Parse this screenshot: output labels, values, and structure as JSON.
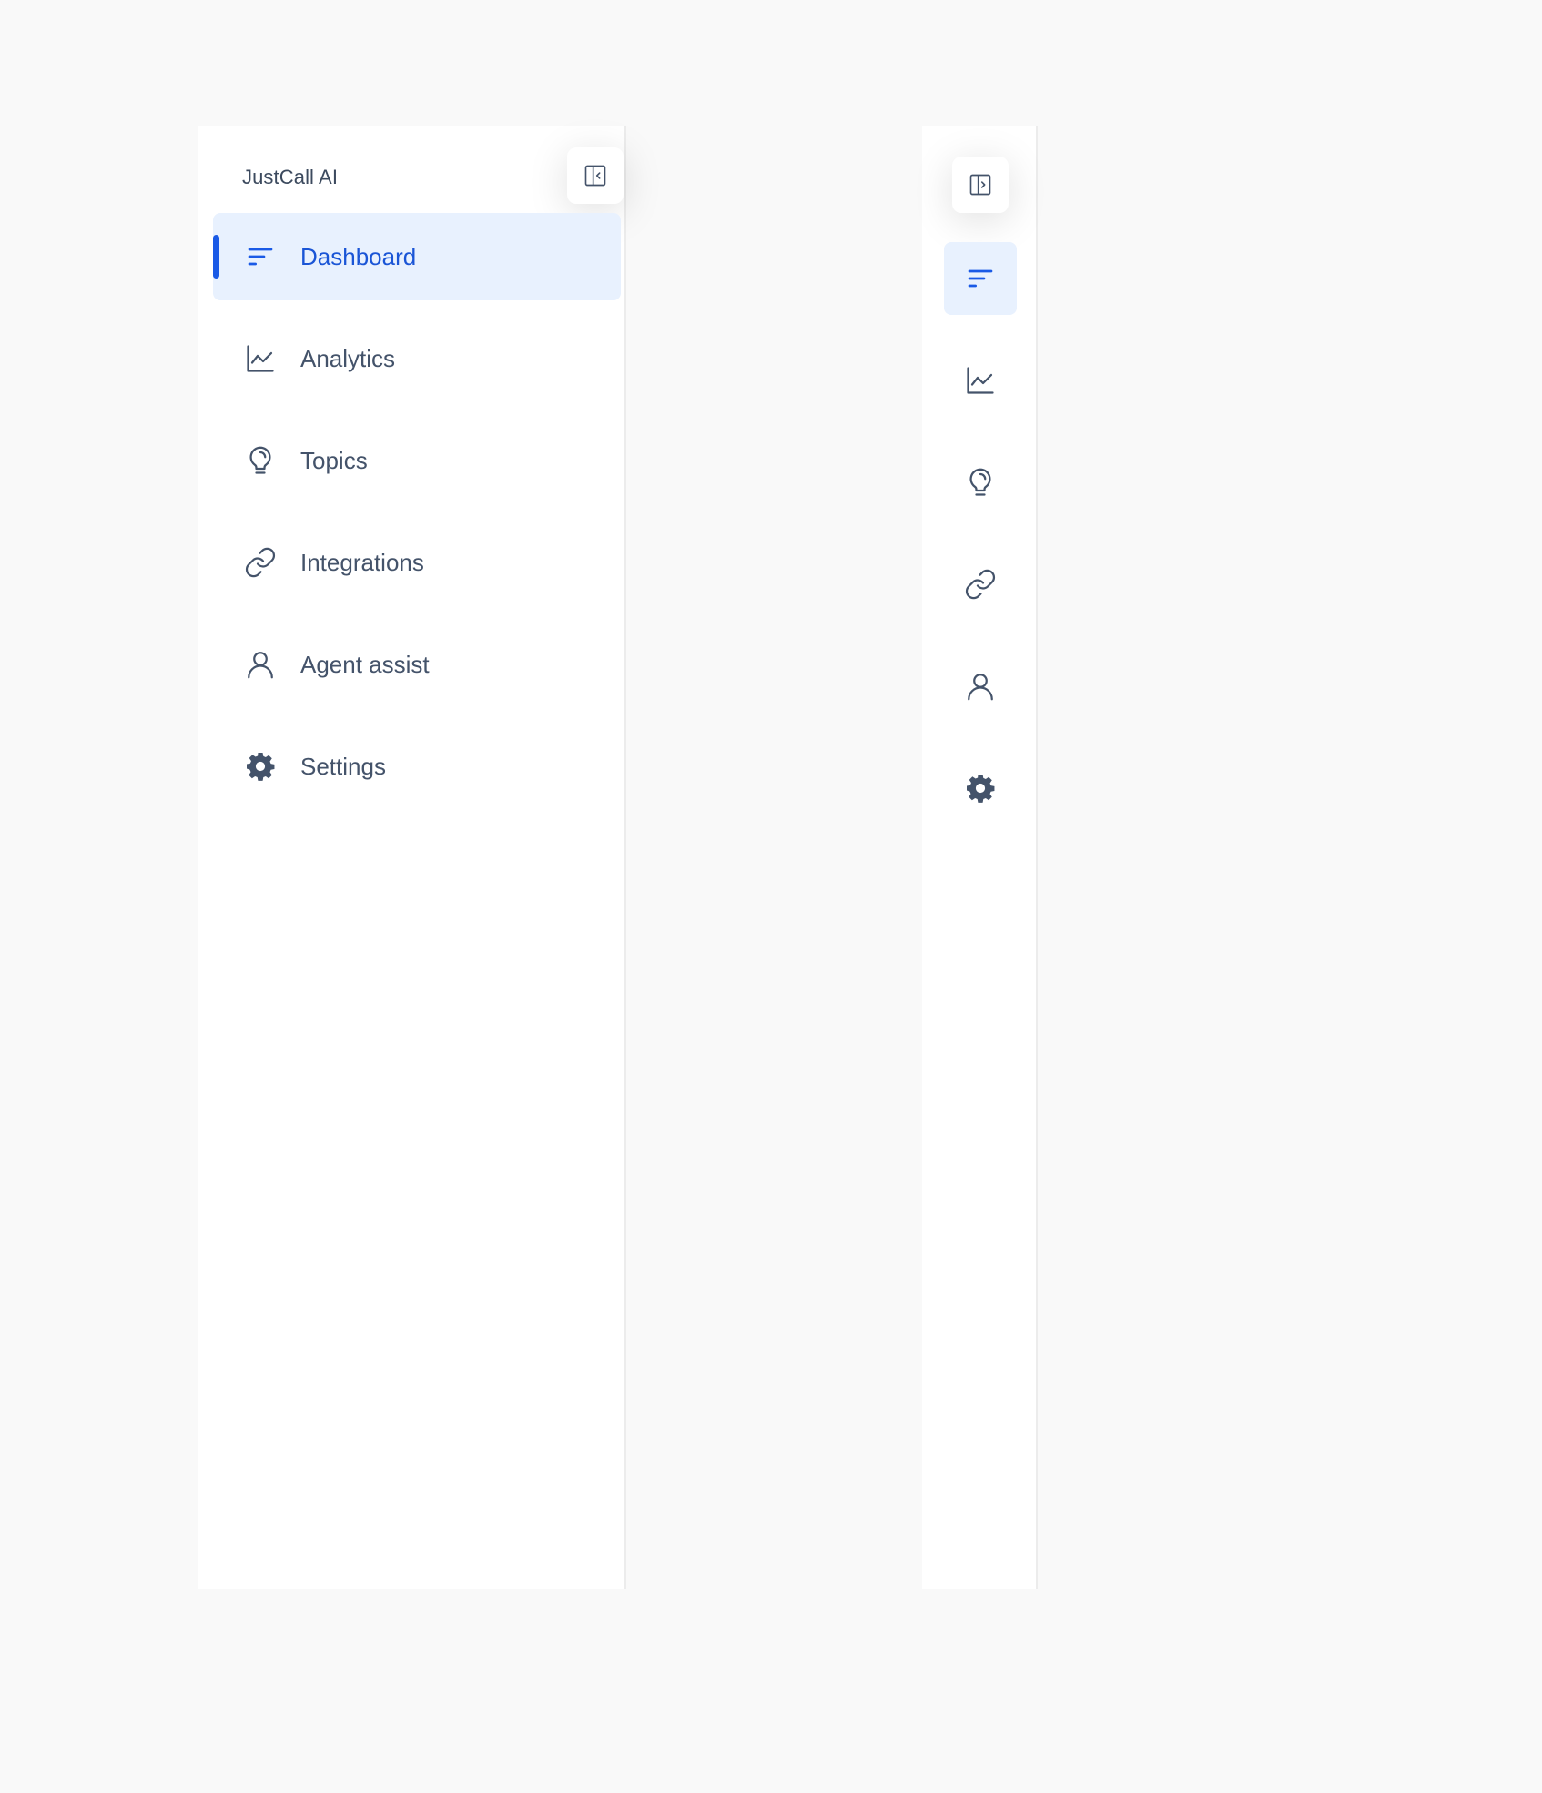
{
  "app": {
    "brand": "JustCall AI"
  },
  "sidebar_expanded": {
    "toggle_icon": "collapse-sidebar-icon",
    "items": [
      {
        "label": "Dashboard",
        "icon": "sort-lines-icon",
        "active": true
      },
      {
        "label": "Analytics",
        "icon": "line-chart-icon",
        "active": false
      },
      {
        "label": "Topics",
        "icon": "lightbulb-icon",
        "active": false
      },
      {
        "label": "Integrations",
        "icon": "link-icon",
        "active": false
      },
      {
        "label": "Agent assist",
        "icon": "user-icon",
        "active": false
      },
      {
        "label": "Settings",
        "icon": "gear-icon",
        "active": false
      }
    ]
  },
  "sidebar_collapsed": {
    "toggle_icon": "expand-sidebar-icon",
    "items": [
      {
        "icon": "sort-lines-icon",
        "active": true
      },
      {
        "icon": "line-chart-icon",
        "active": false
      },
      {
        "icon": "lightbulb-icon",
        "active": false
      },
      {
        "icon": "link-icon",
        "active": false
      },
      {
        "icon": "user-icon",
        "active": false
      },
      {
        "icon": "gear-icon",
        "active": false
      }
    ]
  },
  "colors": {
    "accent": "#1a5ae6",
    "active_bg": "#e8f1fe",
    "text": "#44536a",
    "page_bg": "#f9f9f9"
  }
}
